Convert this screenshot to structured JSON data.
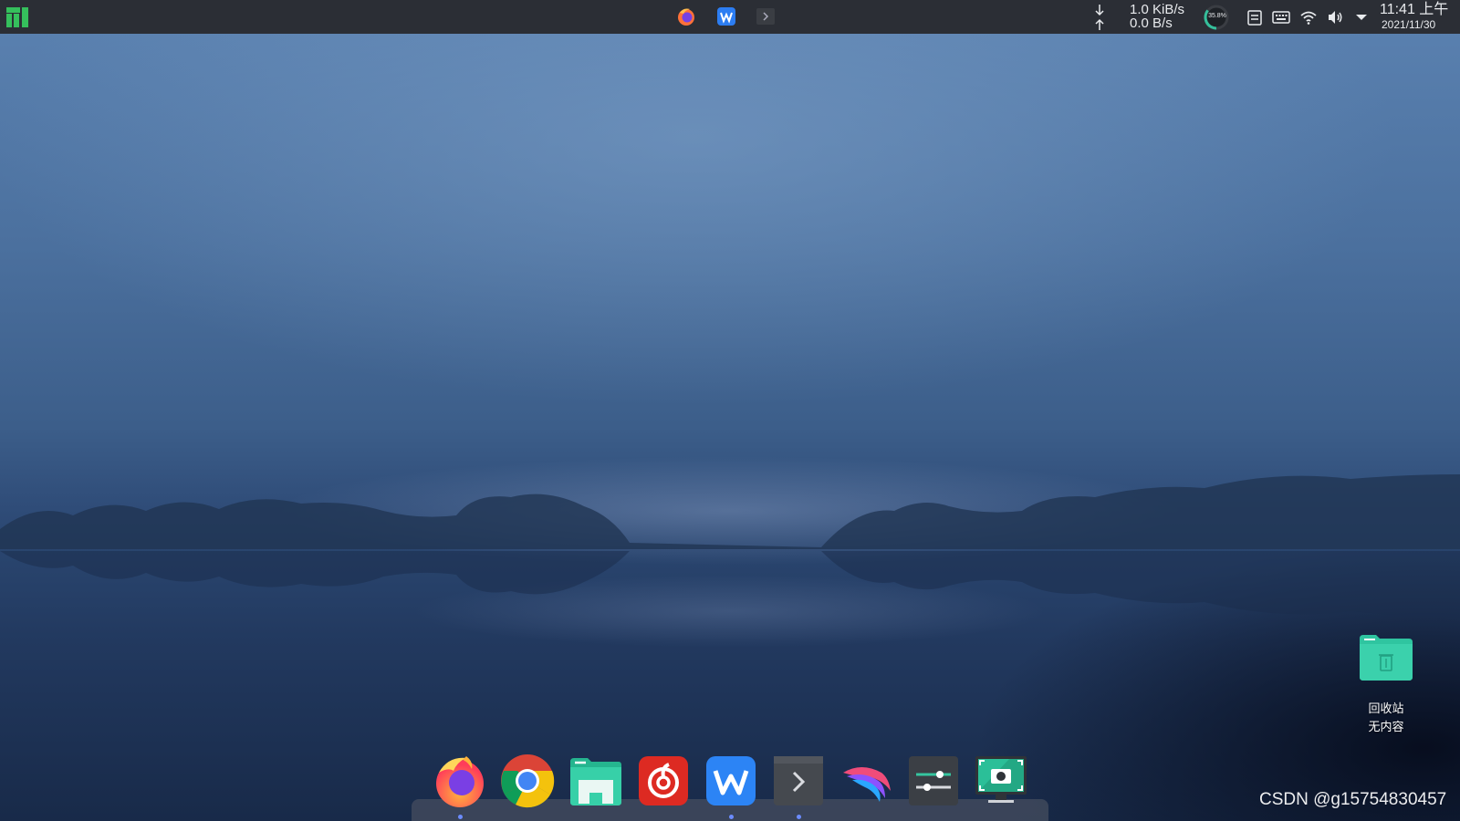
{
  "panel": {
    "menu_icon": "manjaro-logo-icon",
    "taskbar": [
      {
        "name": "firefox",
        "icon": "firefox-icon"
      },
      {
        "name": "wps-office",
        "icon": "wps-icon"
      },
      {
        "name": "terminal",
        "icon": "terminal-icon"
      }
    ],
    "network": {
      "download": "1.0 KiB/s",
      "upload": "0.0 B/s"
    },
    "cpu": {
      "usage_text": "35.8%",
      "usage": 0.358
    },
    "tray": [
      "clipboard-icon",
      "keyboard-icon",
      "wifi-icon",
      "volume-icon",
      "tray-expand-icon"
    ],
    "clock": {
      "time": "11:41 上午",
      "date": "2021/11/30"
    }
  },
  "desktop": {
    "trash": {
      "label": "回收站",
      "status": "无内容",
      "icon": "trash-folder-icon"
    }
  },
  "dock": {
    "apps": [
      {
        "name": "Firefox",
        "icon": "firefox-icon",
        "running": true
      },
      {
        "name": "Chrome",
        "icon": "chrome-icon",
        "running": false
      },
      {
        "name": "Files",
        "icon": "file-manager-icon",
        "running": false
      },
      {
        "name": "NetEase Cloud Music",
        "icon": "netease-music-icon",
        "running": false
      },
      {
        "name": "WPS Office",
        "icon": "wps-icon",
        "running": true
      },
      {
        "name": "Terminal",
        "icon": "terminal-icon",
        "running": true
      },
      {
        "name": "Kali / Dragon",
        "icon": "dragon-app-icon",
        "running": false
      },
      {
        "name": "Settings",
        "icon": "settings-sliders-icon",
        "running": false
      },
      {
        "name": "Screenshot",
        "icon": "screenshot-icon",
        "running": false
      }
    ]
  },
  "watermark": "CSDN @g15754830457",
  "colors": {
    "panel": "#2b2e35",
    "accent_teal": "#35bf9b",
    "dock_indicator": "#6c8cff"
  }
}
